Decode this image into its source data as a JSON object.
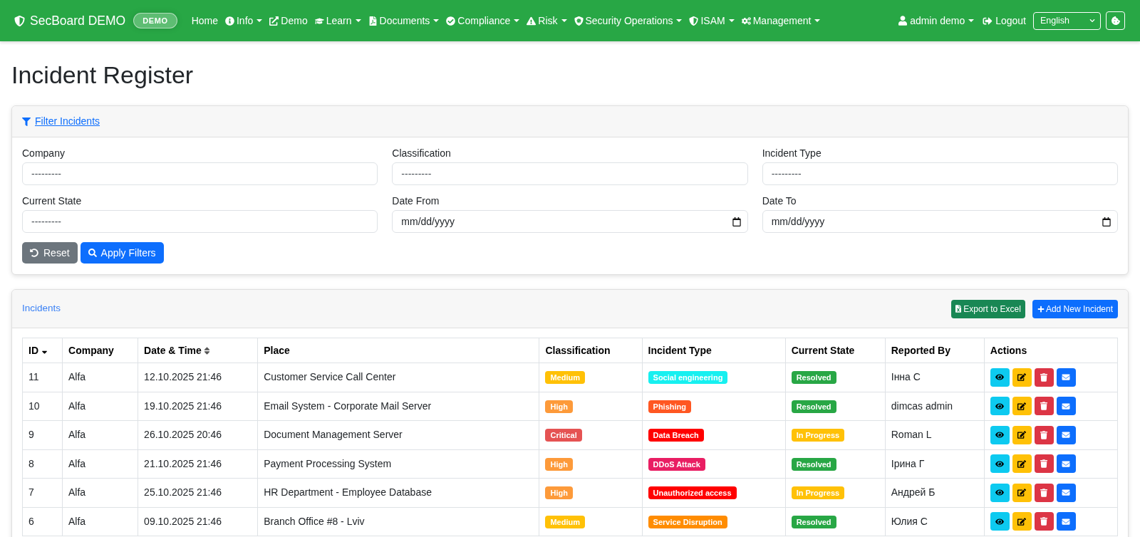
{
  "navbar": {
    "brand": "SecBoard DEMO",
    "badge": "DEMO",
    "items": [
      {
        "label": "Home",
        "dropdown": false
      },
      {
        "label": "Info",
        "dropdown": true
      },
      {
        "label": "Demo",
        "dropdown": false
      },
      {
        "label": "Learn",
        "dropdown": true
      },
      {
        "label": "Documents",
        "dropdown": true
      },
      {
        "label": "Compliance",
        "dropdown": true
      },
      {
        "label": "Risk",
        "dropdown": true
      },
      {
        "label": "Security Operations",
        "dropdown": true
      },
      {
        "label": "ISAM",
        "dropdown": true
      },
      {
        "label": "Management",
        "dropdown": true
      }
    ],
    "user": {
      "label": "admin demo",
      "dropdown": true
    },
    "logout": "Logout",
    "language": "English"
  },
  "page_title": "Incident Register",
  "filters": {
    "title": "Filter Incidents",
    "fields": [
      {
        "label": "Company",
        "kind": "select",
        "value": "---------"
      },
      {
        "label": "Classification",
        "kind": "select",
        "value": "---------"
      },
      {
        "label": "Incident Type",
        "kind": "select",
        "value": "---------"
      },
      {
        "label": "Current State",
        "kind": "select",
        "value": "---------"
      },
      {
        "label": "Date From",
        "kind": "date",
        "placeholder": "mm/dd/yyyy"
      },
      {
        "label": "Date To",
        "kind": "date",
        "placeholder": "mm/dd/yyyy"
      }
    ],
    "buttons": [
      {
        "label": "Reset",
        "kind": "reset"
      },
      {
        "label": "Apply Filters",
        "kind": "apply"
      }
    ]
  },
  "incidents": {
    "title": "Incidents",
    "buttons": [
      {
        "label": "Export to Excel",
        "kind": "export"
      },
      {
        "label": "Add New Incident",
        "kind": "add"
      }
    ],
    "table": {
      "columns": [
        {
          "label": "ID",
          "kind": "sorted"
        },
        {
          "label": "Company",
          "kind": "plain"
        },
        {
          "label": "Date & Time",
          "kind": "sortable"
        },
        {
          "label": "Place",
          "kind": "plain"
        },
        {
          "label": "Classification",
          "kind": "plain"
        },
        {
          "label": "Incident Type",
          "kind": "plain"
        },
        {
          "label": "Current State",
          "kind": "plain"
        },
        {
          "label": "Reported By",
          "kind": "plain"
        },
        {
          "label": "Actions",
          "kind": "plain"
        }
      ],
      "rows": [
        {
          "id": "11",
          "company": "Alfa",
          "date_time": "12.10.2025 21:46",
          "place": "Customer Service Call Center",
          "classification": {
            "label": "Medium",
            "color": "#ffc107"
          },
          "incident_type": {
            "label": "Social engineering",
            "color": "#17f0f0"
          },
          "current_state": {
            "label": "Resolved",
            "color": "#28a745"
          },
          "reported_by": "Інна С"
        },
        {
          "id": "10",
          "company": "Alfa",
          "date_time": "19.10.2025 21:46",
          "place": "Email System - Corporate Mail Server",
          "classification": {
            "label": "High",
            "color": "#fd9a3a"
          },
          "incident_type": {
            "label": "Phishing",
            "color": "#ff5722"
          },
          "current_state": {
            "label": "Resolved",
            "color": "#28a745"
          },
          "reported_by": "dimcas admin"
        },
        {
          "id": "9",
          "company": "Alfa",
          "date_time": "26.10.2025 20:46",
          "place": "Document Management Server",
          "classification": {
            "label": "Critical",
            "color": "#e55353"
          },
          "incident_type": {
            "label": "Data Breach",
            "color": "#ff0000"
          },
          "current_state": {
            "label": "In Progress",
            "color": "#ffc107"
          },
          "reported_by": "Roman L"
        },
        {
          "id": "8",
          "company": "Alfa",
          "date_time": "21.10.2025 21:46",
          "place": "Payment Processing System",
          "classification": {
            "label": "High",
            "color": "#fd9a3a"
          },
          "incident_type": {
            "label": "DDoS Attack",
            "color": "#e91e63"
          },
          "current_state": {
            "label": "Resolved",
            "color": "#28a745"
          },
          "reported_by": "Ірина Г"
        },
        {
          "id": "7",
          "company": "Alfa",
          "date_time": "25.10.2025 21:46",
          "place": "HR Department - Employee Database",
          "classification": {
            "label": "High",
            "color": "#fd9a3a"
          },
          "incident_type": {
            "label": "Unauthorized access",
            "color": "#ff0000"
          },
          "current_state": {
            "label": "In Progress",
            "color": "#ffc107"
          },
          "reported_by": "Андрей Б"
        },
        {
          "id": "6",
          "company": "Alfa",
          "date_time": "09.10.2025 21:46",
          "place": "Branch Office #8 - Lviv",
          "classification": {
            "label": "Medium",
            "color": "#ffc107"
          },
          "incident_type": {
            "label": "Service Disruption",
            "color": "#ff8c00"
          },
          "current_state": {
            "label": "Resolved",
            "color": "#28a745"
          },
          "reported_by": "Юлия С"
        }
      ]
    }
  }
}
